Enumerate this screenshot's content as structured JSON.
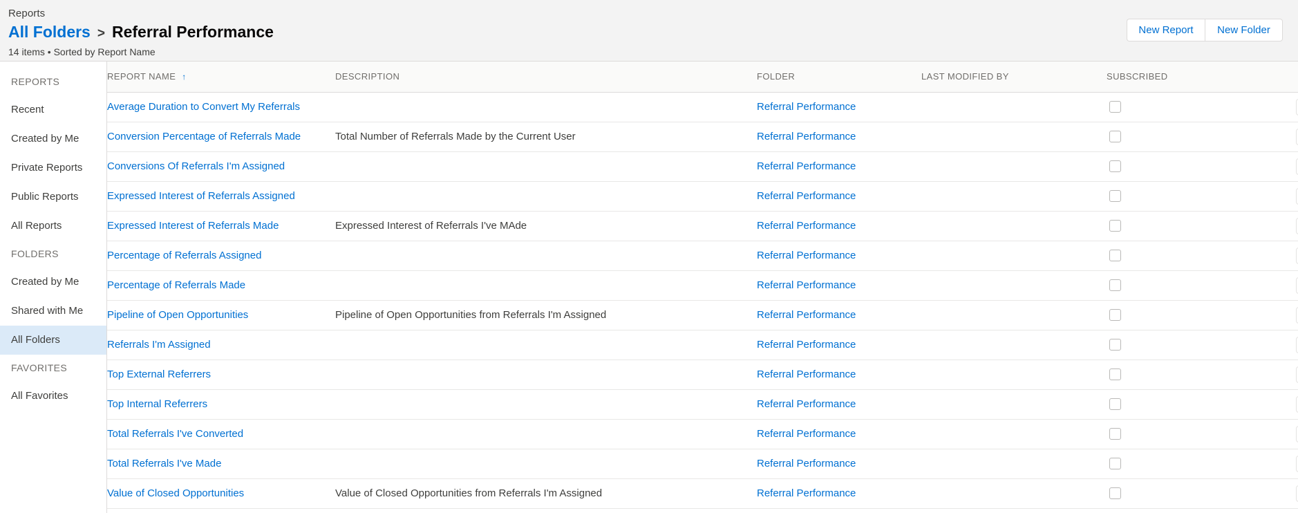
{
  "header": {
    "breadcrumb_root": "Reports",
    "crumb_link": "All Folders",
    "crumb_separator": ">",
    "title": "Referral Performance",
    "subtitle": "14 items • Sorted by Report Name",
    "new_report_label": "New Report",
    "new_folder_label": "New Folder"
  },
  "sidebar": {
    "sections": [
      {
        "label": "REPORTS",
        "items": [
          {
            "label": "Recent",
            "selected": false
          },
          {
            "label": "Created by Me",
            "selected": false
          },
          {
            "label": "Private Reports",
            "selected": false
          },
          {
            "label": "Public Reports",
            "selected": false
          },
          {
            "label": "All Reports",
            "selected": false
          }
        ]
      },
      {
        "label": "FOLDERS",
        "items": [
          {
            "label": "Created by Me",
            "selected": false
          },
          {
            "label": "Shared with Me",
            "selected": false
          },
          {
            "label": "All Folders",
            "selected": true
          }
        ]
      },
      {
        "label": "FAVORITES",
        "items": [
          {
            "label": "All Favorites",
            "selected": false
          }
        ]
      }
    ]
  },
  "table": {
    "columns": [
      {
        "key": "name",
        "label": "REPORT NAME",
        "sorted": true,
        "sort_direction": "asc",
        "sort_glyph": "↑"
      },
      {
        "key": "description",
        "label": "DESCRIPTION",
        "sorted": false
      },
      {
        "key": "folder",
        "label": "FOLDER",
        "sorted": false
      },
      {
        "key": "last_modified_by",
        "label": "LAST MODIFIED BY",
        "sorted": false
      },
      {
        "key": "subscribed",
        "label": "SUBSCRIBED",
        "sorted": false
      }
    ],
    "rows": [
      {
        "name": "Average Duration to Convert My Referrals",
        "description": "",
        "folder": "Referral Performance",
        "last_modified_by": "",
        "subscribed": false
      },
      {
        "name": "Conversion Percentage of Referrals Made",
        "description": "Total Number of Referrals Made by the Current User",
        "folder": "Referral Performance",
        "last_modified_by": "",
        "subscribed": false
      },
      {
        "name": "Conversions Of Referrals I'm Assigned",
        "description": "",
        "folder": "Referral Performance",
        "last_modified_by": "",
        "subscribed": false
      },
      {
        "name": "Expressed Interest of Referrals Assigned",
        "description": "",
        "folder": "Referral Performance",
        "last_modified_by": "",
        "subscribed": false
      },
      {
        "name": "Expressed Interest of Referrals Made",
        "description": "Expressed Interest of Referrals I've MAde",
        "folder": "Referral Performance",
        "last_modified_by": "",
        "subscribed": false
      },
      {
        "name": "Percentage of Referrals Assigned",
        "description": "",
        "folder": "Referral Performance",
        "last_modified_by": "",
        "subscribed": false
      },
      {
        "name": "Percentage of Referrals Made",
        "description": "",
        "folder": "Referral Performance",
        "last_modified_by": "",
        "subscribed": false
      },
      {
        "name": "Pipeline of Open Opportunities",
        "description": "Pipeline of Open Opportunities from Referrals I'm Assigned",
        "folder": "Referral Performance",
        "last_modified_by": "",
        "subscribed": false
      },
      {
        "name": "Referrals I'm Assigned",
        "description": "",
        "folder": "Referral Performance",
        "last_modified_by": "",
        "subscribed": false
      },
      {
        "name": "Top External Referrers",
        "description": "",
        "folder": "Referral Performance",
        "last_modified_by": "",
        "subscribed": false
      },
      {
        "name": "Top Internal Referrers",
        "description": "",
        "folder": "Referral Performance",
        "last_modified_by": "",
        "subscribed": false
      },
      {
        "name": "Total Referrals I've Converted",
        "description": "",
        "folder": "Referral Performance",
        "last_modified_by": "",
        "subscribed": false
      },
      {
        "name": "Total Referrals I've Made",
        "description": "",
        "folder": "Referral Performance",
        "last_modified_by": "",
        "subscribed": false
      },
      {
        "name": "Value of Closed Opportunities",
        "description": "Value of Closed Opportunities from Referrals I'm Assigned",
        "folder": "Referral Performance",
        "last_modified_by": "",
        "subscribed": false
      }
    ],
    "row_menu_icon": "chevron-down-icon"
  },
  "colors": {
    "link": "#0070d2",
    "header_bg": "#f3f3f3",
    "selected_nav_bg": "#dbeaf8",
    "table_head_bg": "#fafaf9",
    "sorted_col_bg": "#ecebea",
    "text": "#3e3e3c",
    "muted_text": "#706e6b",
    "border": "#dddbda"
  }
}
